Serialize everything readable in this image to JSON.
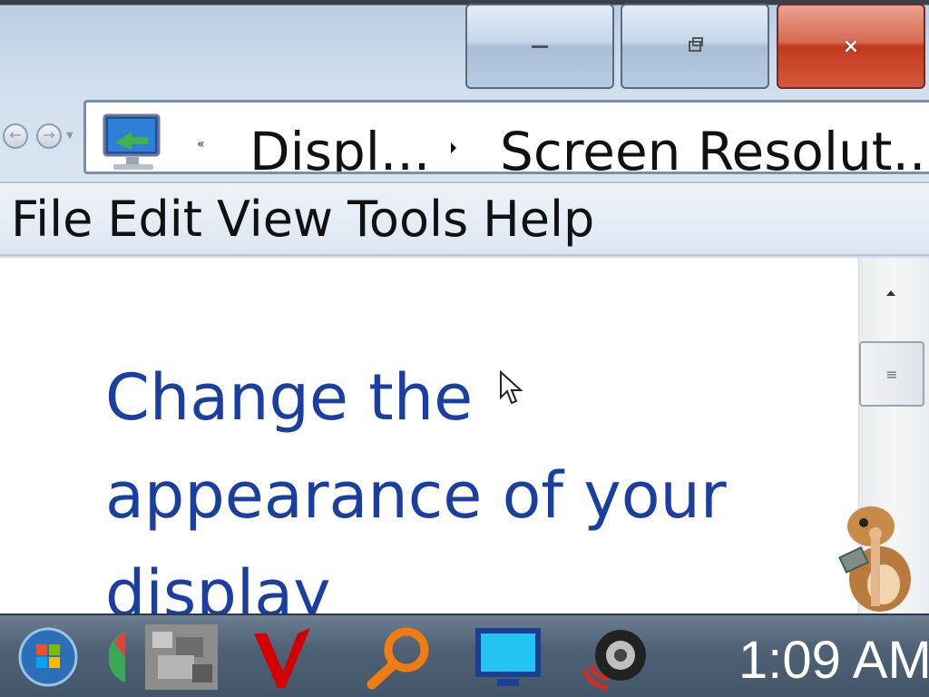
{
  "window": {
    "minimize_label": "–",
    "close_label": "×"
  },
  "breadcrumb": {
    "overflow_chevron": "«",
    "crumbs": [
      "Displ...",
      "Screen Resolut..."
    ]
  },
  "menu": {
    "items": [
      "File",
      "Edit",
      "View",
      "Tools",
      "Help"
    ]
  },
  "content": {
    "heading": "Change the appearance of your display"
  },
  "taskbar": {
    "clock": "1:09 AM",
    "icons": [
      "start-orb-icon",
      "chrome-icon",
      "photo-app-icon",
      "v-app-icon",
      "search-magnifier-icon",
      "display-icon",
      "speaker-icon"
    ]
  },
  "colors": {
    "heading": "#1a3fa0",
    "close_button": "#c23a1e",
    "taskbar": "#4f6275"
  }
}
